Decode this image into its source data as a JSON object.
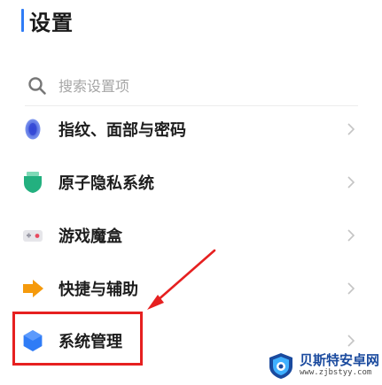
{
  "header": {
    "title": "设置"
  },
  "search": {
    "placeholder": "搜索设置项"
  },
  "items": [
    {
      "label": "指纹、面部与密码",
      "icon": "fingerprint-icon",
      "color": "#5b6ee8"
    },
    {
      "label": "原子隐私系统",
      "icon": "shield-icon",
      "color": "#23b07f"
    },
    {
      "label": "游戏魔盒",
      "icon": "game-controller-icon",
      "color": "#e84a5f"
    },
    {
      "label": "快捷与辅助",
      "icon": "shortcut-arrow-icon",
      "color": "#f59a0c"
    },
    {
      "label": "系统管理",
      "icon": "hexagon-icon",
      "color": "#2f7cf6"
    }
  ],
  "watermark": {
    "name": "贝斯特安卓网",
    "url": "www.zjbstyy.com"
  },
  "colors": {
    "accent": "#2f7cf6",
    "highlight": "#e62020"
  }
}
